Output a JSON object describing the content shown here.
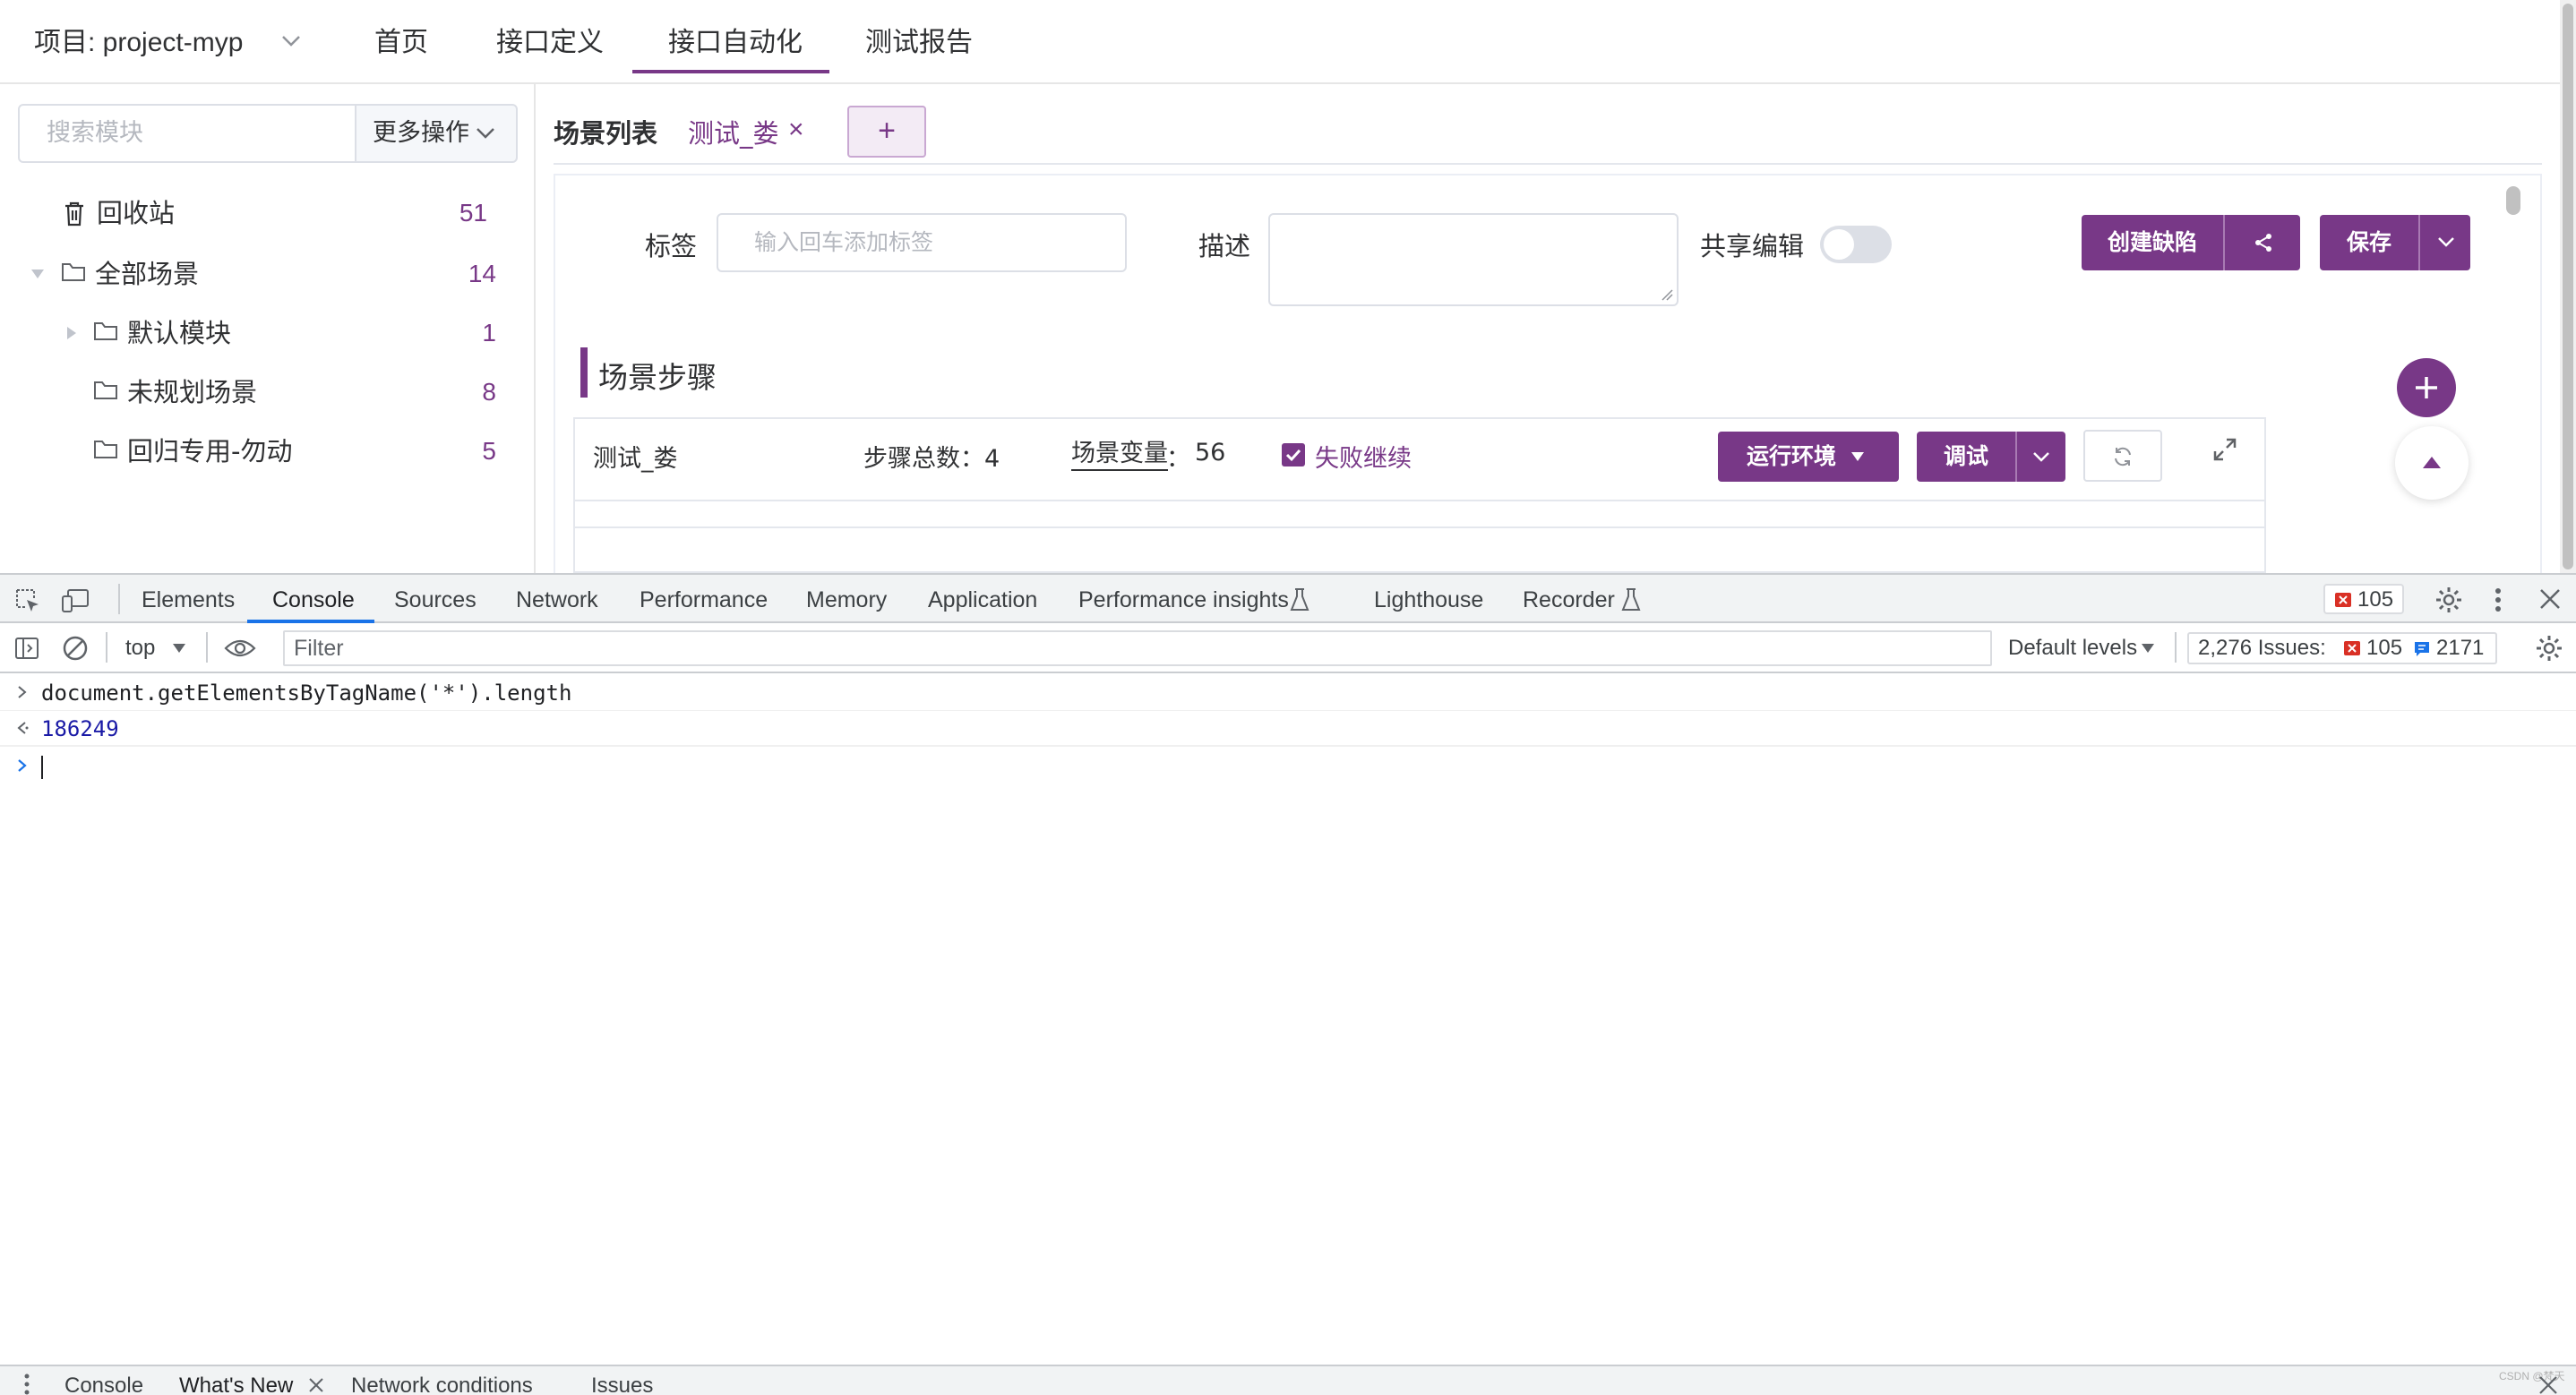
{
  "app": {
    "project_label": "项目: project-myp",
    "nav": [
      "首页",
      "接口定义",
      "接口自动化",
      "测试报告"
    ],
    "nav_active": "接口自动化"
  },
  "sidebar": {
    "search_placeholder": "搜索模块",
    "more_actions": "更多操作",
    "tree": [
      {
        "label": "回收站",
        "count": "51"
      },
      {
        "label": "全部场景",
        "count": "14"
      },
      {
        "label": "默认模块",
        "count": "1"
      },
      {
        "label": "未规划场景",
        "count": "8"
      },
      {
        "label": "回归专用-勿动",
        "count": "5"
      }
    ]
  },
  "tabs": {
    "list_label": "场景列表",
    "active_tab": "测试_娄",
    "close_symbol": "×",
    "add_symbol": "+"
  },
  "form": {
    "tag_label": "标签",
    "tag_placeholder": "输入回车添加标签",
    "desc_label": "描述",
    "share_label": "共享编辑",
    "create_bug": "创建缺陷",
    "save": "保存"
  },
  "steps": {
    "section_title": "场景步骤",
    "scenario_name": "测试_娄",
    "total_label": "步骤总数：4",
    "var_label": "场景变量",
    "var_sep": "：",
    "var_count": "56",
    "continue_on_fail": "失败继续",
    "run_env": "运行环境",
    "debug": "调试"
  },
  "devtools": {
    "tabs": [
      "Elements",
      "Console",
      "Sources",
      "Network",
      "Performance",
      "Memory",
      "Application",
      "Performance insights",
      "Lighthouse",
      "Recorder"
    ],
    "active_tab": "Console",
    "error_count": "105",
    "context": "top",
    "filter_placeholder": "Filter",
    "default_levels": "Default levels",
    "issues_label": "2,276 Issues:",
    "issues_errors": "105",
    "issues_info": "2171",
    "console": {
      "input_code": "document.getElementsByTagName('*').length",
      "output_value": "186249"
    },
    "drawer_tabs": [
      "Console",
      "What's New",
      "Network conditions",
      "Issues"
    ],
    "watermark": "CSDN @梵天"
  },
  "colors": {
    "brand": "#783887",
    "devtools_accent": "#1a73e8",
    "error": "#d93025"
  }
}
